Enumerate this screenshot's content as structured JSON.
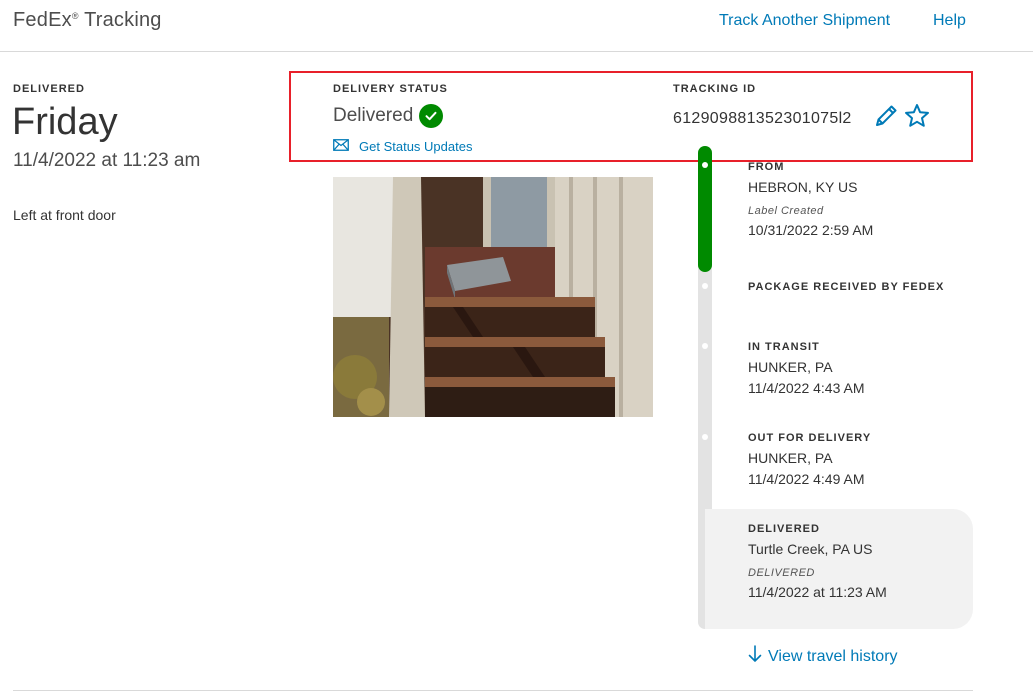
{
  "header": {
    "brand": "FedEx",
    "brand_reg": "®",
    "brand_suffix": "Tracking",
    "links": [
      "Track Another Shipment",
      "Help"
    ]
  },
  "summary": {
    "label": "DELIVERED",
    "day": "Friday",
    "datetime": "11/4/2022 at 11:23 am",
    "note": "Left at front door"
  },
  "status": {
    "label": "DELIVERY STATUS",
    "value": "Delivered",
    "updates_link": "Get Status Updates",
    "tracking_label": "TRACKING ID",
    "tracking_id": "612909881352301075l2"
  },
  "timeline": {
    "progress_fraction": 0.26,
    "events": [
      {
        "title": "FROM",
        "location": "HEBRON, KY US",
        "subtitle": "Label Created",
        "time": "10/31/2022 2:59 AM"
      },
      {
        "title": "PACKAGE RECEIVED BY FEDEX"
      },
      {
        "title": "IN TRANSIT",
        "location": "HUNKER, PA",
        "time": "11/4/2022 4:43 AM"
      },
      {
        "title": "OUT FOR DELIVERY",
        "location": "HUNKER, PA",
        "time": "11/4/2022 4:49 AM"
      },
      {
        "title": "DELIVERED",
        "location": "Turtle Creek, PA US",
        "subtitle": "DELIVERED",
        "time": "11/4/2022 at 11:23 AM"
      }
    ],
    "history_link": "View travel history"
  },
  "colors": {
    "link": "#007ab7",
    "success": "#008a00",
    "highlight_box": "#e8202a"
  },
  "icons": {
    "status": "check-circle-icon",
    "updates": "envelope-icon",
    "edit": "pencil-icon",
    "favorite": "star-icon",
    "history": "arrow-down-icon"
  }
}
